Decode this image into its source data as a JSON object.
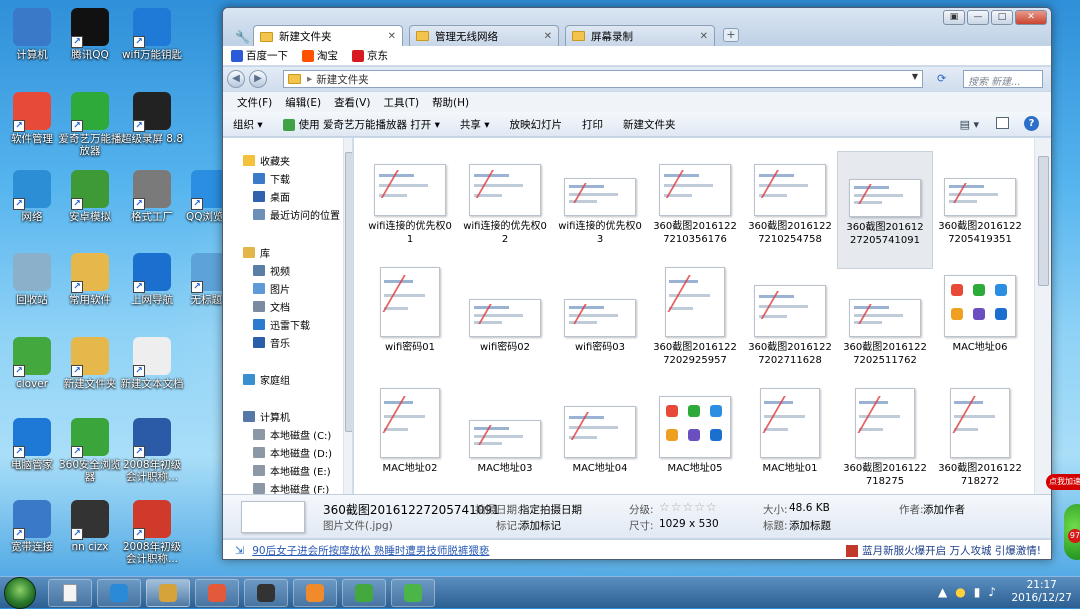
{
  "desktop": {
    "icons": [
      {
        "label": "计算机",
        "icon": "computer-icon",
        "color": "#3a78c8"
      },
      {
        "label": "腾讯QQ",
        "icon": "qq-icon",
        "color": "#111111"
      },
      {
        "label": "wifi万能钥匙",
        "icon": "wifi-key-icon",
        "color": "#1e7ad6"
      },
      {
        "label": "软件管理",
        "icon": "software-manager-icon",
        "color": "#e84a3a"
      },
      {
        "label": "爱奇艺万能播放器",
        "icon": "iqiyi-player-icon",
        "color": "#2eaa3a"
      },
      {
        "label": "超级录屏 8.8",
        "icon": "screen-recorder-icon",
        "color": "#222222"
      },
      {
        "label": "网络",
        "icon": "network-icon",
        "color": "#2c8fd6"
      },
      {
        "label": "安卓模拟",
        "icon": "android-emulator-icon",
        "color": "#3d9a36"
      },
      {
        "label": "格式工厂",
        "icon": "format-factory-icon",
        "color": "#7a7a7a"
      },
      {
        "label": "QQ浏览器",
        "icon": "qq-browser-icon",
        "color": "#2b8ee0"
      },
      {
        "label": "回收站",
        "icon": "recycle-bin-icon",
        "color": "#8ab1c9"
      },
      {
        "label": "常用软件",
        "icon": "folder-icon",
        "color": "#e6b84b"
      },
      {
        "label": "上网导航",
        "icon": "ie-icon",
        "color": "#1b6fcf"
      },
      {
        "label": "无标题 (",
        "icon": "wma-file-icon",
        "color": "#5da2d8"
      },
      {
        "label": "clover",
        "icon": "clover-icon",
        "color": "#43a83e"
      },
      {
        "label": "新建文件夹",
        "icon": "folder-icon",
        "color": "#e6b84b"
      },
      {
        "label": "新建文本文档",
        "icon": "text-file-icon",
        "color": "#eeeeee"
      },
      {
        "label": "电脑管家",
        "icon": "pc-manager-icon",
        "color": "#1e78d6"
      },
      {
        "label": "360安全浏览器",
        "icon": "360-browser-icon",
        "color": "#3aa53a"
      },
      {
        "label": "2008年初级会计职称...",
        "icon": "word-doc-icon",
        "color": "#2b5ba6"
      },
      {
        "label": "宽带连接",
        "icon": "broadband-icon",
        "color": "#3a78c8"
      },
      {
        "label": "nn cizx",
        "icon": "media-icon",
        "color": "#333333"
      },
      {
        "label": "2008年初级会计职称...",
        "icon": "pdf-icon",
        "color": "#d03a2a"
      }
    ]
  },
  "window": {
    "tabs": [
      {
        "label": "新建文件夹",
        "active": true
      },
      {
        "label": "管理无线网络",
        "active": false
      },
      {
        "label": "屏幕录制",
        "active": false
      }
    ],
    "favorites": [
      {
        "label": "百度一下",
        "icon": "baidu-icon",
        "color": "#2b5bd8"
      },
      {
        "label": "淘宝",
        "icon": "taobao-icon",
        "color": "#ff5000"
      },
      {
        "label": "京东",
        "icon": "jd-icon",
        "color": "#d71920"
      }
    ],
    "address": "新建文件夹",
    "search_placeholder": "搜索 新建...",
    "menu": [
      "文件(F)",
      "编辑(E)",
      "查看(V)",
      "工具(T)",
      "帮助(H)"
    ],
    "commands": {
      "organize": "组织",
      "open_with": "使用 爱奇艺万能播放器 打开",
      "share": "共享",
      "slideshow": "放映幻灯片",
      "print": "打印",
      "new_folder": "新建文件夹"
    },
    "nav": {
      "favorites_header": "收藏夹",
      "favorites": [
        "下载",
        "桌面",
        "最近访问的位置"
      ],
      "library_header": "库",
      "library": [
        "视频",
        "图片",
        "文档",
        "迅雷下载",
        "音乐"
      ],
      "homegroup": "家庭组",
      "computer_header": "计算机",
      "drives": [
        "本地磁盘 (C:)",
        "本地磁盘 (D:)",
        "本地磁盘 (E:)",
        "本地磁盘 (F:)"
      ]
    },
    "files": [
      {
        "name": "wifi连接的优先权01",
        "kind": "shot"
      },
      {
        "name": "wifi连接的优先权02",
        "kind": "shot"
      },
      {
        "name": "wifi连接的优先权03",
        "kind": "wide"
      },
      {
        "name": "360截图20161227210356176",
        "kind": "shot"
      },
      {
        "name": "360截图20161227210254758",
        "kind": "shot"
      },
      {
        "name": "360截图20161227205741091",
        "kind": "wide",
        "selected": true
      },
      {
        "name": "360截图20161227205419351",
        "kind": "wide"
      },
      {
        "name": "wifi密码01",
        "kind": "tall"
      },
      {
        "name": "wifi密码02",
        "kind": "wide"
      },
      {
        "name": "wifi密码03",
        "kind": "wide"
      },
      {
        "name": "360截图20161227202925957",
        "kind": "tall"
      },
      {
        "name": "360截图20161227202711628",
        "kind": "shot"
      },
      {
        "name": "360截图20161227202511762",
        "kind": "wide"
      },
      {
        "name": "MAC地址06",
        "kind": "icons"
      },
      {
        "name": "MAC地址02",
        "kind": "tall"
      },
      {
        "name": "MAC地址03",
        "kind": "wide"
      },
      {
        "name": "MAC地址04",
        "kind": "shot"
      },
      {
        "name": "MAC地址05",
        "kind": "icons"
      },
      {
        "name": "MAC地址01",
        "kind": "tall"
      },
      {
        "name": "360截图2016122718275",
        "kind": "tall"
      },
      {
        "name": "360截图2016122718272",
        "kind": "tall"
      }
    ],
    "details": {
      "filename": "360截图20161227205741091",
      "filetype": "图片文件(.jpg)",
      "date_label": "拍摄日期:",
      "date_value": "指定拍摄日期",
      "tags_label": "标记:",
      "tags_value": "添加标记",
      "rating_label": "分级:",
      "dims_label": "尺寸:",
      "dims_value": "1029 x 530",
      "size_label": "大小:",
      "size_value": "48.6 KB",
      "title_label": "标题:",
      "title_value": "添加标题",
      "author_label": "作者:",
      "author_value": "添加作者"
    },
    "status": {
      "left": "90后女子进会所按摩放松 熟睡时遭男技师脱裤猥亵",
      "right": "蓝月新服火爆开启 万人攻城 引爆激情!"
    }
  },
  "taskbar": {
    "buttons": [
      {
        "icon": "document-icon",
        "color": "#f4f4f4"
      },
      {
        "icon": "qq-icon",
        "color": "#2a8ad8"
      },
      {
        "icon": "media-player-icon",
        "color": "#d6a33a"
      },
      {
        "icon": "recorder-icon",
        "color": "#e35a3a"
      },
      {
        "icon": "clapper-icon",
        "color": "#333333"
      },
      {
        "icon": "fox-icon",
        "color": "#f08a2a"
      },
      {
        "icon": "clover-icon",
        "color": "#43a83e"
      },
      {
        "icon": "360-browser-icon",
        "color": "#4bb548"
      }
    ],
    "time": "21:17",
    "date": "2016/12/27"
  },
  "ad": {
    "badge": "点我加速",
    "count": "97"
  },
  "colors": {
    "accent": "#1e5fc8",
    "selected": "#e6eaef"
  }
}
